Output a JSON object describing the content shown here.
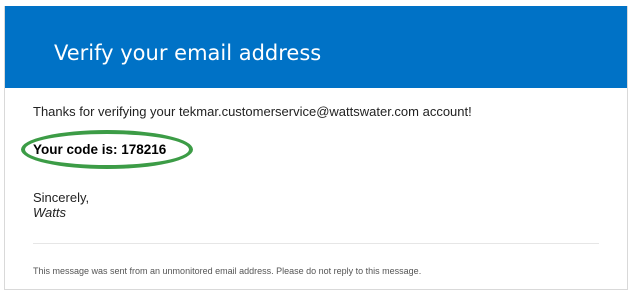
{
  "colors": {
    "header_bg": "#0072c6",
    "highlight_ring": "#3c9c46"
  },
  "header": {
    "title": "Verify your email address"
  },
  "message": {
    "intro": "Thanks for verifying your tekmar.customerservice@wattswater.com account!",
    "code_line": "Your code is: 178216",
    "closing": "Sincerely,",
    "signature": "Watts"
  },
  "footer": {
    "note": "This message was sent from an unmonitored email address. Please do not reply to this message."
  }
}
